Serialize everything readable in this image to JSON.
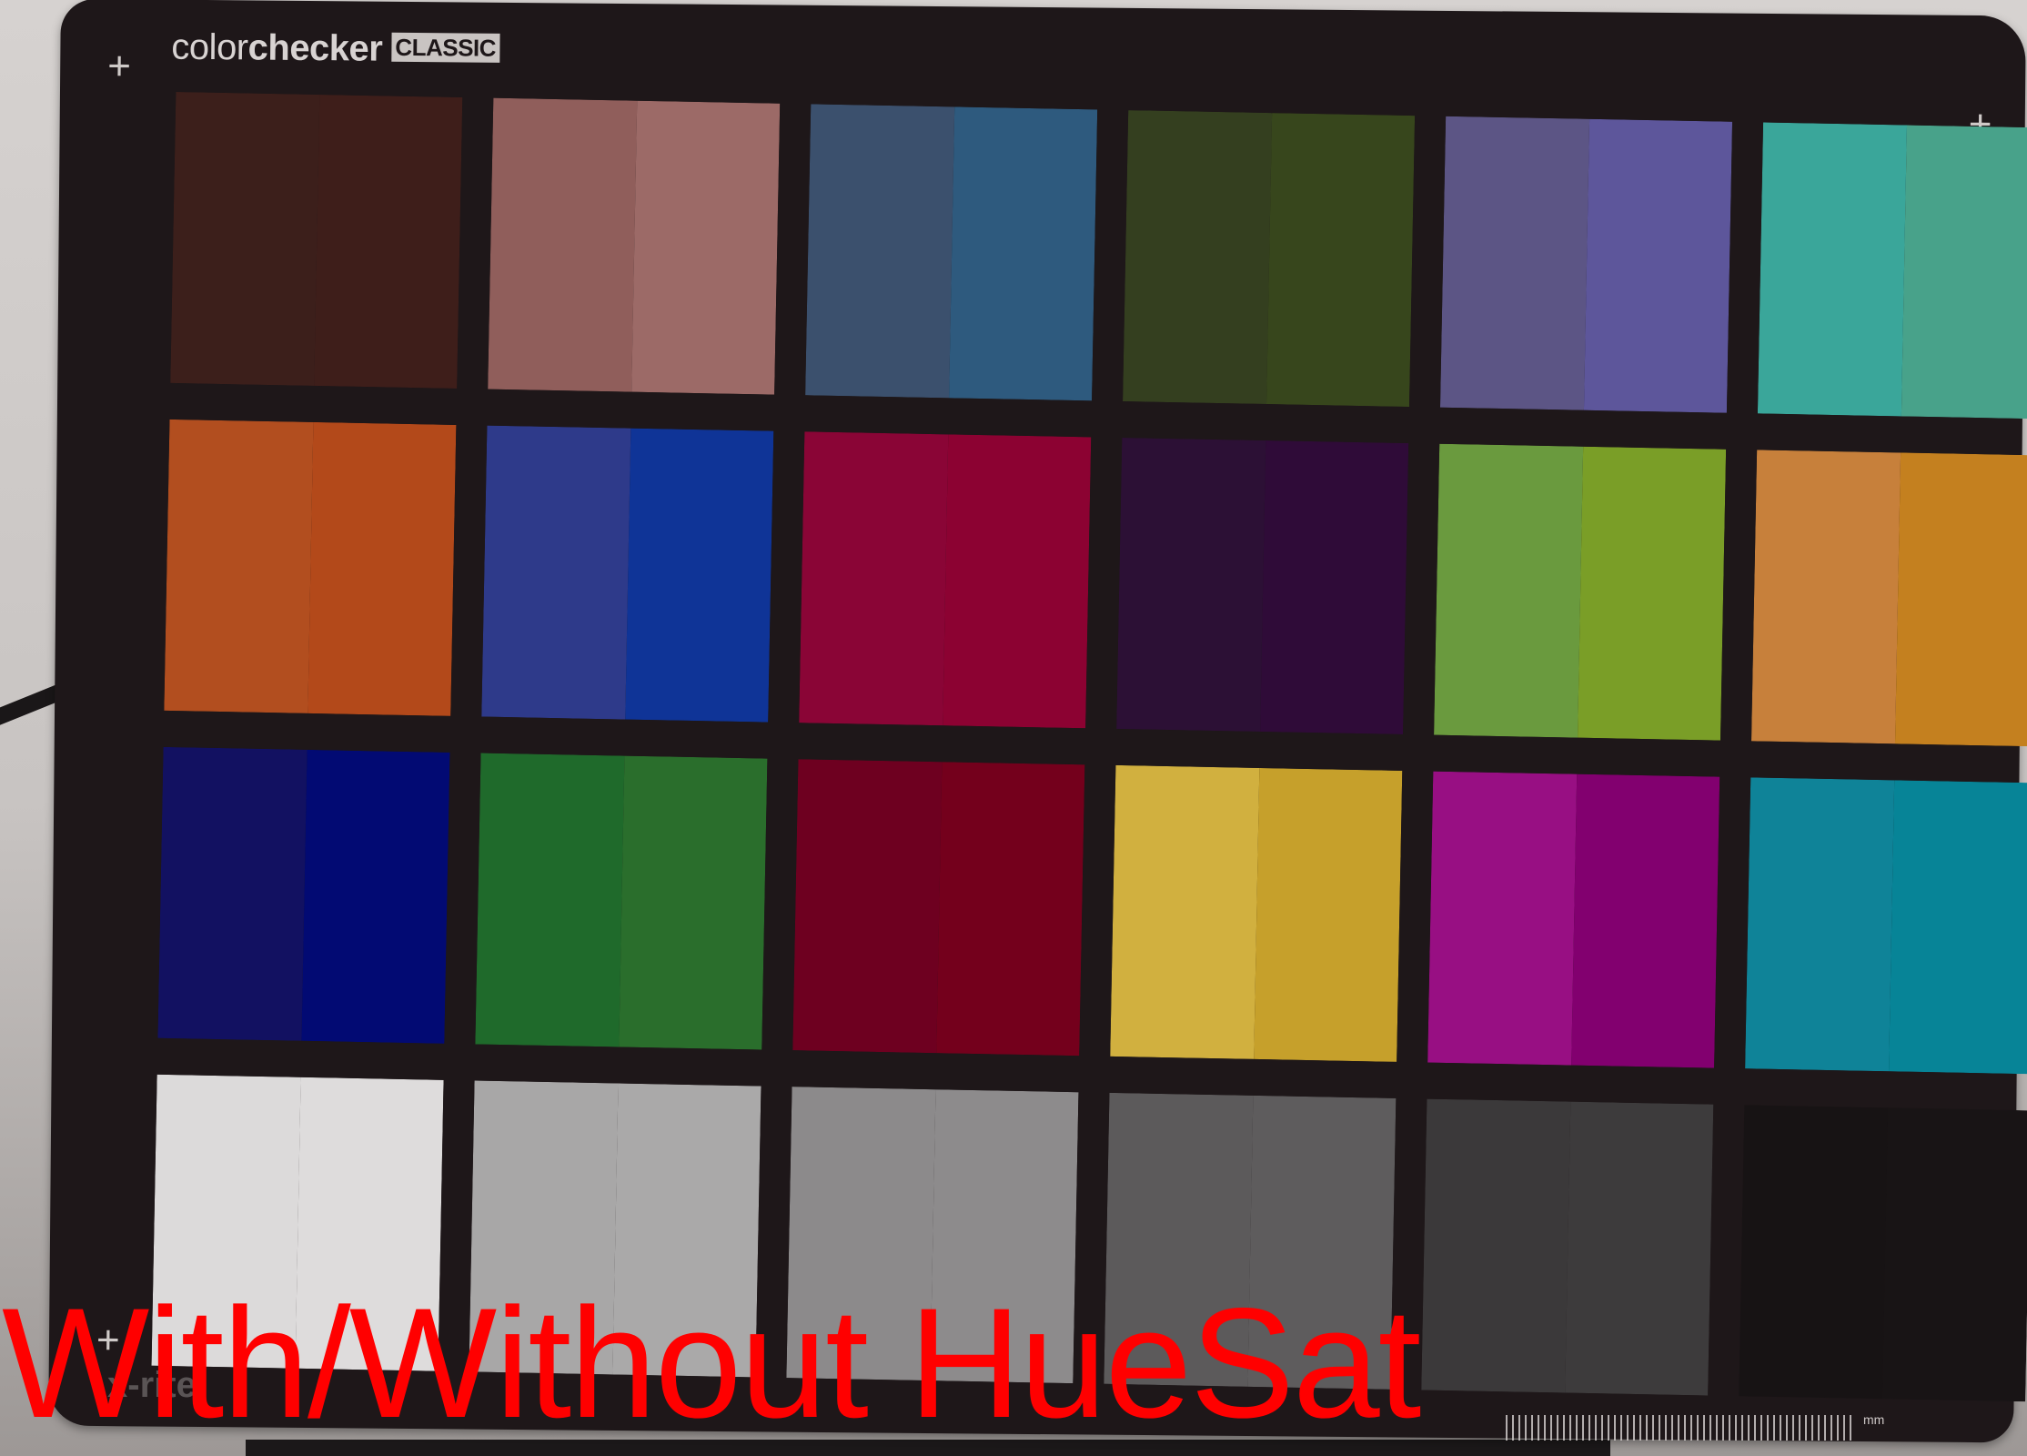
{
  "logo": {
    "light": "color",
    "bold": "checker",
    "badge": "CLASSIC"
  },
  "brand": "x-rite",
  "ruler_unit": "mm",
  "overlay_caption": "With/Without HueSat",
  "patches": [
    {
      "name": "dark-skin",
      "left": "#3c1f1b",
      "right": "#3e1e1a"
    },
    {
      "name": "light-skin",
      "left": "#905e5b",
      "right": "#9c6a67"
    },
    {
      "name": "blue-sky",
      "left": "#3b506d",
      "right": "#2e5a7e"
    },
    {
      "name": "foliage",
      "left": "#343f1f",
      "right": "#37461c"
    },
    {
      "name": "blue-flower",
      "left": "#5c5585",
      "right": "#5d569b"
    },
    {
      "name": "bluish-green",
      "left": "#3aa69a",
      "right": "#48a28a"
    },
    {
      "name": "orange",
      "left": "#b24e1f",
      "right": "#b3491a"
    },
    {
      "name": "purplish-blue",
      "left": "#2e3a8a",
      "right": "#0f3497"
    },
    {
      "name": "moderate-red",
      "left": "#8a0536",
      "right": "#8c0232"
    },
    {
      "name": "purple",
      "left": "#2c1035",
      "right": "#2f0b38"
    },
    {
      "name": "yellow-green",
      "left": "#6a9a3e",
      "right": "#7a9e27"
    },
    {
      "name": "orange-yellow",
      "left": "#c7803b",
      "right": "#c4801f"
    },
    {
      "name": "blue",
      "left": "#121161",
      "right": "#020a73"
    },
    {
      "name": "green",
      "left": "#1f6a2b",
      "right": "#2a6e2c"
    },
    {
      "name": "red",
      "left": "#6e0020",
      "right": "#74001c"
    },
    {
      "name": "yellow",
      "left": "#d1b03f",
      "right": "#c6a02b"
    },
    {
      "name": "magenta",
      "left": "#980f83",
      "right": "#82006f"
    },
    {
      "name": "cyan",
      "left": "#0f8398",
      "right": "#078497"
    },
    {
      "name": "white",
      "left": "#dcdada",
      "right": "#dedcdc"
    },
    {
      "name": "neutral-8",
      "left": "#a8a7a7",
      "right": "#aaa9a9"
    },
    {
      "name": "neutral-6-5",
      "left": "#8c8a8b",
      "right": "#8d8b8c"
    },
    {
      "name": "neutral-5",
      "left": "#5c5a5b",
      "right": "#5e5c5d"
    },
    {
      "name": "neutral-3-5",
      "left": "#3b393a",
      "right": "#3d3b3c"
    },
    {
      "name": "black",
      "left": "#171314",
      "right": "#181415"
    }
  ]
}
